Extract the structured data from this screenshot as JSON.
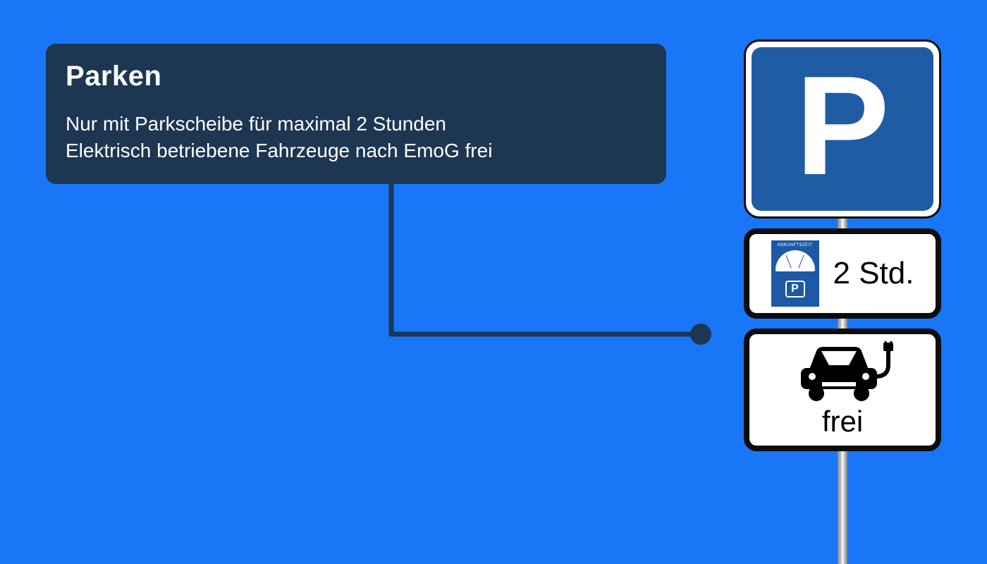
{
  "info": {
    "title": "Parken",
    "line1": "Nur mit Parkscheibe für maximal 2 Stunden",
    "line2": "Elektrisch betriebene Fahrzeuge nach EmoG frei"
  },
  "signs": {
    "p_letter": "P",
    "disc": {
      "top_label": "ANKUNFTSZEIT",
      "mini_p": "P",
      "duration": "2 Std."
    },
    "ev": {
      "label": "frei"
    }
  },
  "colors": {
    "bg": "#1976f6",
    "panel": "#1d3652",
    "sign_blue": "#1f5ca3"
  }
}
